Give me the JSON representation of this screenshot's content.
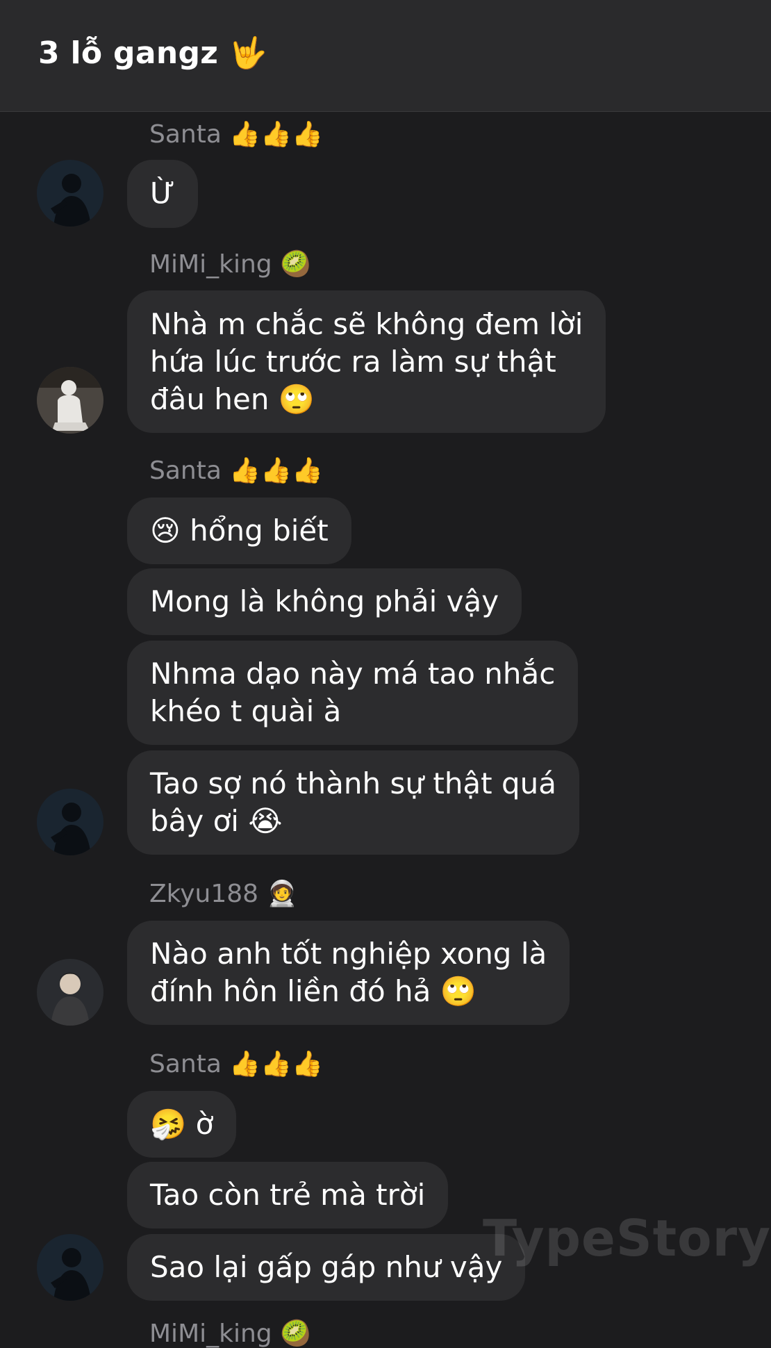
{
  "header": {
    "title": "3 lỗ gangz 🤟"
  },
  "messages": [
    {
      "sender": "Santa 👍👍👍",
      "text": "Ừ"
    },
    {
      "sender": "MiMi_king 🥝",
      "text": "Nhà m chắc sẽ không đem lời\nhứa lúc trước ra làm sự thật\nđâu hen 🙄"
    },
    {
      "sender": "Santa 👍👍👍",
      "text": "😢 hổng biết"
    },
    {
      "text": "Mong là không phải vậy"
    },
    {
      "text": "Nhma dạo này má tao nhắc\nkhéo t quài à"
    },
    {
      "text": "Tao sợ nó thành sự thật quá\nbây ơi 😭"
    },
    {
      "sender": "Zkyu188 🧑‍🚀",
      "text": "Nào anh tốt nghiệp xong là\nđính hôn liền đó hả 🙄"
    },
    {
      "sender": "Santa 👍👍👍",
      "text": "🤧 ờ"
    },
    {
      "text": "Tao còn trẻ mà trời"
    },
    {
      "text": "Sao lại gấp gáp như vậy"
    }
  ],
  "partial_sender": "MiMi_king 🥝",
  "watermark": "TypeStory",
  "colors": {
    "background": "#1c1c1e",
    "header": "#2a2a2c",
    "bubble": "#2c2c2e",
    "sender": "#8e8e93"
  }
}
